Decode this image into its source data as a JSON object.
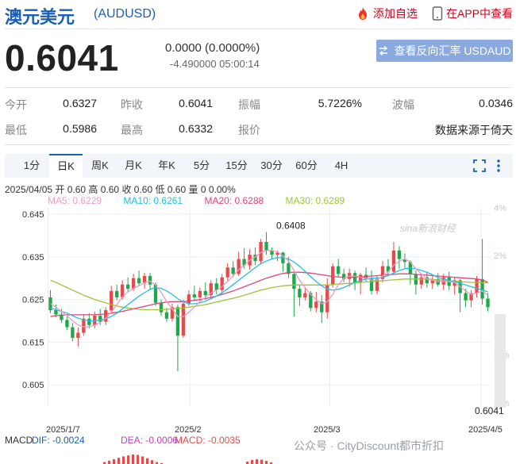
{
  "header": {
    "title": "澳元美元",
    "code": "(AUDUSD)",
    "add_watch": "添加自选",
    "open_app": "在APP中查看"
  },
  "quote": {
    "price": "0.6041",
    "change": "0.0000 (0.0000%)",
    "sub": "-4.490000 05:00:14",
    "reverse_button": "查看反向汇率 USDAUD"
  },
  "stats": {
    "open_label": "今开",
    "open_value": "0.6327",
    "prev_label": "昨收",
    "prev_value": "0.6041",
    "amp_label": "振幅",
    "amp_value": "5.7226%",
    "wave_label": "波幅",
    "wave_value": "0.0346",
    "low_label": "最低",
    "low_value": "0.5986",
    "high_label": "最高",
    "high_value": "0.6332",
    "quote_label": "报价",
    "source": "数据来源于倚天"
  },
  "tabs": [
    "1分",
    "日K",
    "周K",
    "月K",
    "年K",
    "5分",
    "15分",
    "30分",
    "60分",
    "4H"
  ],
  "active_tab": 1,
  "info_line": "2025/04/05 开 0.60 高 0.60 收 0.60 低 0.60 量 0 0.00%",
  "ma": {
    "ma5": "MA5: 0.6229",
    "ma10": "MA10: 0.6261",
    "ma20": "MA20: 0.6288",
    "ma30": "MA30: 0.6289"
  },
  "colors": {
    "up": "#e84a4a",
    "down": "#1fa84a",
    "ma5": "#f19ac6",
    "ma10": "#22c0e0",
    "ma20": "#e0457a",
    "ma30": "#9dc33c",
    "brand": "#1a5fb4"
  },
  "chart_data": {
    "type": "candlestick",
    "y_ticks": [
      "0.645",
      "0.635",
      "0.625",
      "0.615",
      "0.605"
    ],
    "right_ticks": [
      "4%",
      "2%",
      "-1%",
      "-4%"
    ],
    "x_ticks": [
      "2025/1/7",
      "2025/2",
      "2025/3",
      "2025/4/5"
    ],
    "ylim": [
      0.6,
      0.6465
    ],
    "high_label": "0.6408",
    "last_label": "0.6041",
    "watermark": "sina新浪财经",
    "candles": [
      [
        0.6255,
        0.6225,
        0.6272,
        0.6218
      ],
      [
        0.6225,
        0.6215,
        0.6238,
        0.6208
      ],
      [
        0.6215,
        0.6202,
        0.6228,
        0.6195
      ],
      [
        0.6202,
        0.6185,
        0.621,
        0.6178
      ],
      [
        0.6185,
        0.616,
        0.6195,
        0.6152
      ],
      [
        0.616,
        0.6172,
        0.6185,
        0.614
      ],
      [
        0.6172,
        0.6205,
        0.6215,
        0.6165
      ],
      [
        0.6205,
        0.619,
        0.6218,
        0.6182
      ],
      [
        0.619,
        0.6212,
        0.6222,
        0.6182
      ],
      [
        0.6212,
        0.6198,
        0.6228,
        0.619
      ],
      [
        0.6198,
        0.6225,
        0.6232,
        0.619
      ],
      [
        0.6225,
        0.627,
        0.6282,
        0.6218
      ],
      [
        0.627,
        0.6255,
        0.6285,
        0.6248
      ],
      [
        0.6255,
        0.6285,
        0.6295,
        0.625
      ],
      [
        0.6285,
        0.6275,
        0.6302,
        0.6268
      ],
      [
        0.6275,
        0.63,
        0.631,
        0.627
      ],
      [
        0.63,
        0.6288,
        0.6318,
        0.6282
      ],
      [
        0.6288,
        0.6305,
        0.6312,
        0.6275
      ],
      [
        0.6305,
        0.6285,
        0.6312,
        0.6272
      ],
      [
        0.6285,
        0.6242,
        0.629,
        0.6235
      ],
      [
        0.6242,
        0.622,
        0.625,
        0.6212
      ],
      [
        0.622,
        0.6205,
        0.623,
        0.6198
      ],
      [
        0.6205,
        0.6232,
        0.624,
        0.6198
      ],
      [
        0.6232,
        0.6165,
        0.6238,
        0.6082
      ],
      [
        0.6165,
        0.624,
        0.625,
        0.616
      ],
      [
        0.624,
        0.6262,
        0.6272,
        0.6235
      ],
      [
        0.6262,
        0.6255,
        0.6282,
        0.6248
      ],
      [
        0.6255,
        0.627,
        0.6278,
        0.6245
      ],
      [
        0.627,
        0.626,
        0.629,
        0.625
      ],
      [
        0.626,
        0.6288,
        0.6295,
        0.6252
      ],
      [
        0.6288,
        0.6272,
        0.63,
        0.6262
      ],
      [
        0.6272,
        0.6302,
        0.631,
        0.6262
      ],
      [
        0.6302,
        0.6325,
        0.6335,
        0.6295
      ],
      [
        0.6325,
        0.631,
        0.634,
        0.6302
      ],
      [
        0.631,
        0.6345,
        0.6362,
        0.6305
      ],
      [
        0.6345,
        0.633,
        0.637,
        0.6322
      ],
      [
        0.633,
        0.6355,
        0.6368,
        0.632
      ],
      [
        0.6355,
        0.634,
        0.6372,
        0.633
      ],
      [
        0.634,
        0.6385,
        0.6392,
        0.6332
      ],
      [
        0.6385,
        0.6365,
        0.6408,
        0.6355
      ],
      [
        0.6365,
        0.6355,
        0.6372,
        0.6345
      ],
      [
        0.6355,
        0.636,
        0.6365,
        0.634
      ],
      [
        0.636,
        0.6335,
        0.6362,
        0.6315
      ],
      [
        0.6335,
        0.631,
        0.635,
        0.63
      ],
      [
        0.631,
        0.6275,
        0.6315,
        0.621
      ],
      [
        0.6275,
        0.6255,
        0.6285,
        0.6235
      ],
      [
        0.6255,
        0.6265,
        0.628,
        0.6248
      ],
      [
        0.6265,
        0.623,
        0.627,
        0.6222
      ],
      [
        0.623,
        0.6245,
        0.6268,
        0.622
      ],
      [
        0.6245,
        0.622,
        0.626,
        0.6195
      ],
      [
        0.622,
        0.6285,
        0.63,
        0.6205
      ],
      [
        0.6285,
        0.6328,
        0.6335,
        0.6278
      ],
      [
        0.6328,
        0.631,
        0.6345,
        0.6302
      ],
      [
        0.631,
        0.6298,
        0.6322,
        0.629
      ],
      [
        0.6298,
        0.6312,
        0.6322,
        0.628
      ],
      [
        0.6312,
        0.629,
        0.6318,
        0.6272
      ],
      [
        0.629,
        0.6308,
        0.6312,
        0.6262
      ],
      [
        0.6308,
        0.6298,
        0.6325,
        0.629
      ],
      [
        0.6298,
        0.627,
        0.6318,
        0.6262
      ],
      [
        0.627,
        0.6298,
        0.6305,
        0.6262
      ],
      [
        0.6298,
        0.6328,
        0.634,
        0.629
      ],
      [
        0.6328,
        0.6315,
        0.6345,
        0.6305
      ],
      [
        0.6315,
        0.6365,
        0.6385,
        0.631
      ],
      [
        0.6365,
        0.6345,
        0.6375,
        0.6322
      ],
      [
        0.6345,
        0.6338,
        0.6358,
        0.6322
      ],
      [
        0.6338,
        0.631,
        0.6342,
        0.6285
      ],
      [
        0.631,
        0.6285,
        0.6318,
        0.6262
      ],
      [
        0.6285,
        0.6302,
        0.631,
        0.6275
      ],
      [
        0.6302,
        0.6288,
        0.6315,
        0.6278
      ],
      [
        0.6288,
        0.6298,
        0.6305,
        0.6275
      ],
      [
        0.6298,
        0.6285,
        0.6312,
        0.628
      ],
      [
        0.6285,
        0.6302,
        0.631,
        0.6272
      ],
      [
        0.6302,
        0.6282,
        0.6315,
        0.6272
      ],
      [
        0.6282,
        0.6295,
        0.6302,
        0.6262
      ],
      [
        0.6295,
        0.6265,
        0.6298,
        0.622
      ],
      [
        0.6265,
        0.6248,
        0.6275,
        0.6232
      ],
      [
        0.6248,
        0.6265,
        0.6272,
        0.6232
      ],
      [
        0.6265,
        0.6298,
        0.6305,
        0.6255
      ],
      [
        0.6298,
        0.6252,
        0.6392,
        0.6238
      ],
      [
        0.6252,
        0.6232,
        0.6265,
        0.6222
      ]
    ],
    "ma_lines": {
      "ma5": [
        0.624,
        0.6232,
        0.6222,
        0.6212,
        0.62,
        0.619,
        0.6186,
        0.6186,
        0.619,
        0.6196,
        0.6206,
        0.622,
        0.6238,
        0.6256,
        0.6268,
        0.6276,
        0.6282,
        0.629,
        0.6293,
        0.6284,
        0.6267,
        0.6245,
        0.6228,
        0.621,
        0.621,
        0.622,
        0.6232,
        0.6245,
        0.6255,
        0.6265,
        0.6272,
        0.628,
        0.6293,
        0.6305,
        0.632,
        0.633,
        0.6342,
        0.635,
        0.636,
        0.6365,
        0.6365,
        0.6362,
        0.6352,
        0.634,
        0.6318,
        0.6295,
        0.6278,
        0.6262,
        0.625,
        0.624,
        0.6245,
        0.6262,
        0.6285,
        0.63,
        0.6305,
        0.6305,
        0.6302,
        0.63,
        0.6295,
        0.6296,
        0.6305,
        0.6315,
        0.633,
        0.634,
        0.6345,
        0.6338,
        0.6322,
        0.631,
        0.6298,
        0.6295,
        0.6292,
        0.6292,
        0.6292,
        0.629,
        0.628,
        0.627,
        0.6262,
        0.6265,
        0.627,
        0.626
      ],
      "ma10": [
        0.623,
        0.6226,
        0.6222,
        0.6218,
        0.6212,
        0.6206,
        0.6202,
        0.62,
        0.62,
        0.6202,
        0.6205,
        0.621,
        0.6218,
        0.6228,
        0.6238,
        0.6248,
        0.6258,
        0.6266,
        0.6274,
        0.6278,
        0.6276,
        0.627,
        0.6262,
        0.6252,
        0.6244,
        0.624,
        0.624,
        0.6242,
        0.6246,
        0.6252,
        0.6258,
        0.6266,
        0.6275,
        0.6285,
        0.6295,
        0.6305,
        0.6315,
        0.6325,
        0.6334,
        0.634,
        0.6345,
        0.6348,
        0.6348,
        0.6345,
        0.6338,
        0.6328,
        0.6316,
        0.6304,
        0.6292,
        0.6282,
        0.6275,
        0.6272,
        0.6274,
        0.6278,
        0.6284,
        0.629,
        0.6294,
        0.6298,
        0.63,
        0.63,
        0.6302,
        0.6306,
        0.6312,
        0.6318,
        0.6322,
        0.6324,
        0.6322,
        0.6318,
        0.6314,
        0.6308,
        0.6302,
        0.6298,
        0.6294,
        0.6292,
        0.6288,
        0.6284,
        0.628,
        0.6276,
        0.6272,
        0.6268
      ],
      "ma20": [
        0.621,
        0.6212,
        0.6213,
        0.6214,
        0.6214,
        0.6214,
        0.6214,
        0.6214,
        0.6214,
        0.6215,
        0.6216,
        0.6218,
        0.622,
        0.6222,
        0.6225,
        0.6228,
        0.6231,
        0.6234,
        0.6237,
        0.624,
        0.6242,
        0.6244,
        0.6245,
        0.6245,
        0.6245,
        0.6246,
        0.6248,
        0.625,
        0.6252,
        0.6255,
        0.6258,
        0.6262,
        0.6266,
        0.627,
        0.6275,
        0.628,
        0.6285,
        0.629,
        0.6295,
        0.63,
        0.6304,
        0.6308,
        0.6311,
        0.6313,
        0.6314,
        0.6314,
        0.6313,
        0.6312,
        0.631,
        0.6308,
        0.6306,
        0.6304,
        0.6303,
        0.6302,
        0.6302,
        0.6302,
        0.6303,
        0.6304,
        0.6305,
        0.6306,
        0.6307,
        0.6308,
        0.6309,
        0.631,
        0.631,
        0.631,
        0.6309,
        0.6308,
        0.6307,
        0.6306,
        0.6305,
        0.6304,
        0.6303,
        0.6302,
        0.6301,
        0.63,
        0.6299,
        0.6298,
        0.6296,
        0.629
      ],
      "ma30": [
        0.6295,
        0.629,
        0.6284,
        0.6278,
        0.6272,
        0.6266,
        0.626,
        0.6255,
        0.625,
        0.6246,
        0.6242,
        0.6238,
        0.6235,
        0.6232,
        0.623,
        0.6228,
        0.6227,
        0.6226,
        0.6226,
        0.6226,
        0.6226,
        0.6227,
        0.6228,
        0.6229,
        0.623,
        0.6232,
        0.6234,
        0.6236,
        0.6238,
        0.6241,
        0.6244,
        0.6247,
        0.625,
        0.6253,
        0.6256,
        0.626,
        0.6264,
        0.6268,
        0.6272,
        0.6275,
        0.6278,
        0.628,
        0.6282,
        0.6283,
        0.6284,
        0.6284,
        0.6284,
        0.6284,
        0.6284,
        0.6284,
        0.6284,
        0.6285,
        0.6286,
        0.6287,
        0.6288,
        0.6289,
        0.629,
        0.6291,
        0.6292,
        0.6293,
        0.6294,
        0.6295,
        0.6296,
        0.6297,
        0.6298,
        0.6298,
        0.6298,
        0.6298,
        0.6298,
        0.6297,
        0.6296,
        0.6295,
        0.6294,
        0.6293,
        0.6292,
        0.6291,
        0.629,
        0.629,
        0.6289,
        0.6289
      ]
    },
    "macd": {
      "label": "MACD",
      "dif": "DIF: -0.0024",
      "dea": "DEA: -0.0006",
      "macd": "MACD: -0.0035",
      "bars": [
        0.2,
        0.35,
        0.5,
        0.65,
        0.8,
        0.9,
        1.0,
        0.95,
        0.8,
        0.6,
        0.4,
        0.2,
        0.1
      ],
      "bars_red_start_index": 12,
      "bars_red_values": [
        0.3,
        0.5,
        0.6,
        0.55,
        0.4,
        0.2
      ]
    }
  },
  "watermark_footer": "公众号 · CityDiscount都市折扣"
}
